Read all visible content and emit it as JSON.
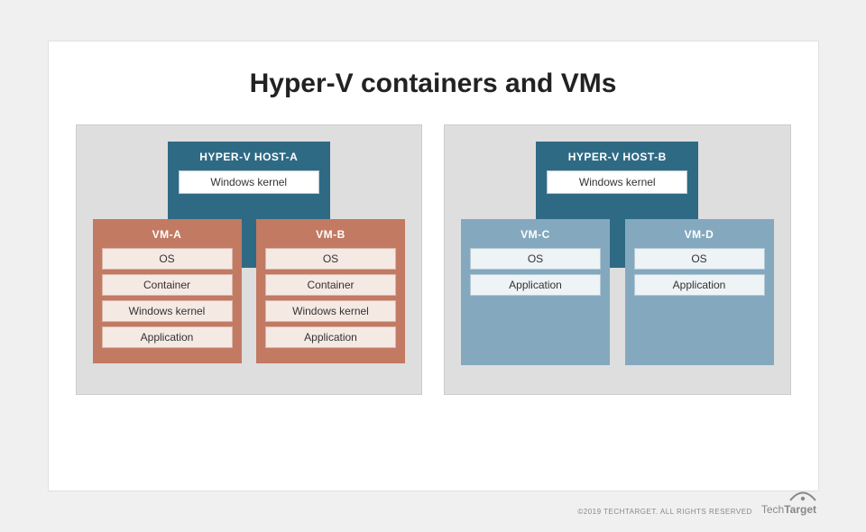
{
  "title": "Hyper-V containers and VMs",
  "hostA": {
    "label": "HYPER-V HOST-A",
    "kernel": "Windows kernel",
    "vmA": {
      "label": "VM-A",
      "rows": [
        "OS",
        "Container",
        "Windows kernel",
        "Application"
      ]
    },
    "vmB": {
      "label": "VM-B",
      "rows": [
        "OS",
        "Container",
        "Windows kernel",
        "Application"
      ]
    }
  },
  "hostB": {
    "label": "HYPER-V HOST-B",
    "kernel": "Windows kernel",
    "vmC": {
      "label": "VM-C",
      "rows": [
        "OS",
        "Application"
      ]
    },
    "vmD": {
      "label": "VM-D",
      "rows": [
        "OS",
        "Application"
      ]
    }
  },
  "footer": {
    "copyright": "©2019 TECHTARGET. ALL RIGHTS RESERVED",
    "logo_prefix": "Tech",
    "logo_suffix": "Target"
  }
}
